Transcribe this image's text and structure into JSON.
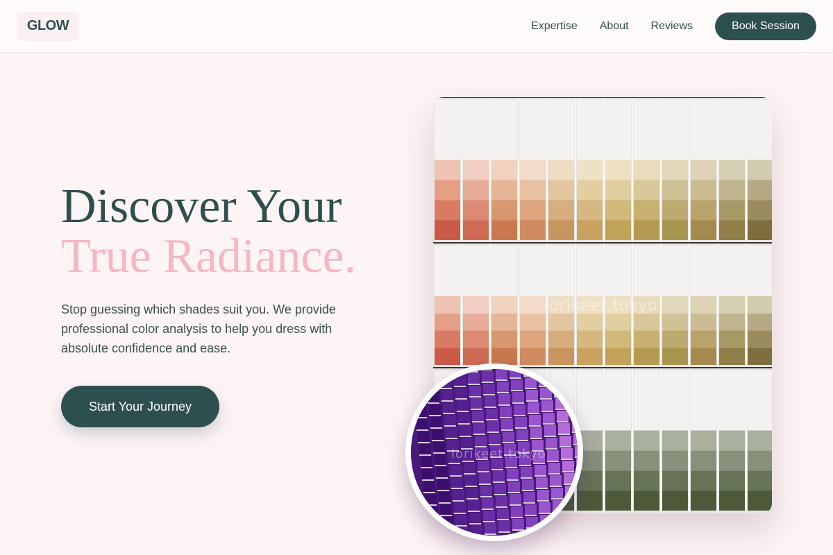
{
  "header": {
    "logo": "GLOW",
    "nav": [
      "Expertise",
      "About",
      "Reviews"
    ],
    "cta": "Book Session"
  },
  "hero": {
    "title_line1": "Discover Your",
    "title_line2": "True Radiance.",
    "description": "Stop guessing which shades suit you. We provide professional color analysis to help you dress with absolute confidence and ease.",
    "cta": "Start Your Journey"
  },
  "images": {
    "main_watermark": "lorikeet.tokyo",
    "circle_watermark": "lorikeet.tokyo"
  },
  "colors": {
    "background": "#fdf4f5",
    "primary": "#2e4f4f",
    "accent_pink": "#f7b6c4",
    "white": "#ffffff"
  }
}
